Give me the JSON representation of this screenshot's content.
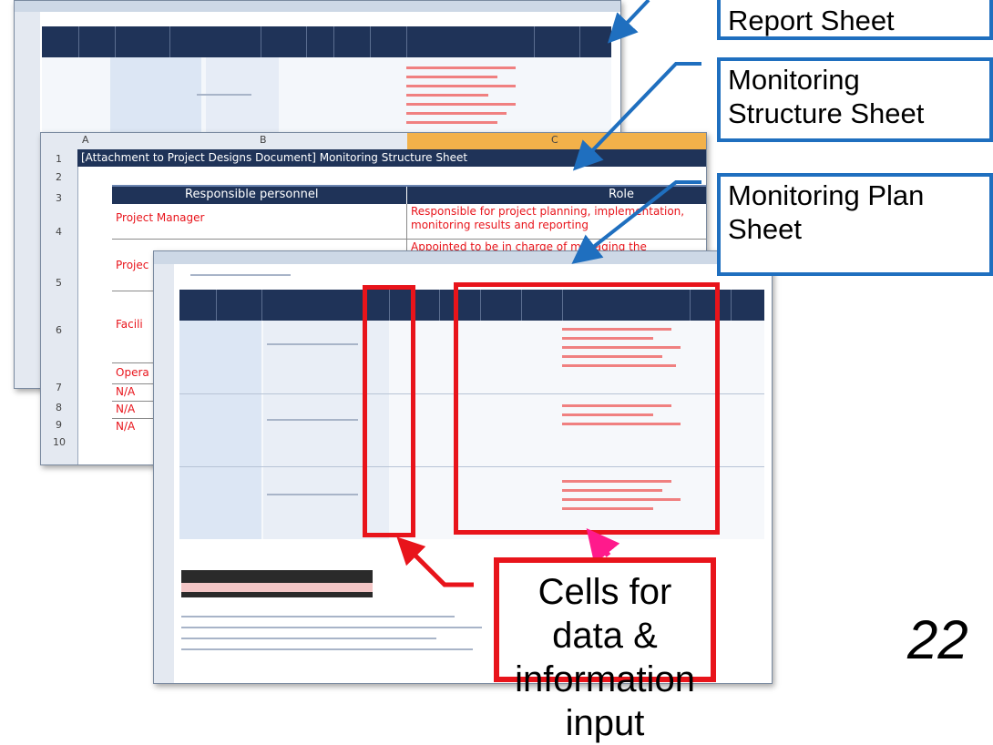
{
  "callouts": {
    "report_sheet": "Report Sheet",
    "structure_sheet": "Monitoring Structure Sheet",
    "plan_sheet": "Monitoring Plan Sheet"
  },
  "structure_sheet": {
    "col_letters": [
      "A",
      "B",
      "C"
    ],
    "row_numbers": [
      "1",
      "2",
      "3",
      "4",
      "5",
      "6",
      "7",
      "8",
      "9",
      "10"
    ],
    "title": "[Attachment to Project Designs Document] Monitoring Structure Sheet",
    "header_personnel": "Responsible personnel",
    "header_role": "Role",
    "personnel": [
      "Project Manager",
      "Projec",
      "Facili",
      "Opera",
      "N/A",
      "N/A",
      "N/A"
    ],
    "roles": [
      "Responsible for project planning, implementation, monitoring results and reporting",
      "Appointed to be in charge of managing the"
    ]
  },
  "input_label": "Cells for data & information input",
  "page_number": "22",
  "colors": {
    "accent_blue": "#1f6fbf",
    "highlight_red": "#e8141b",
    "header_navy": "#1f3358",
    "cell_blue": "#dce6f4"
  },
  "icons": [
    "arrow-report-icon",
    "arrow-structure-icon",
    "arrow-plan-icon",
    "arrow-input-left-icon",
    "arrow-input-right-icon"
  ]
}
